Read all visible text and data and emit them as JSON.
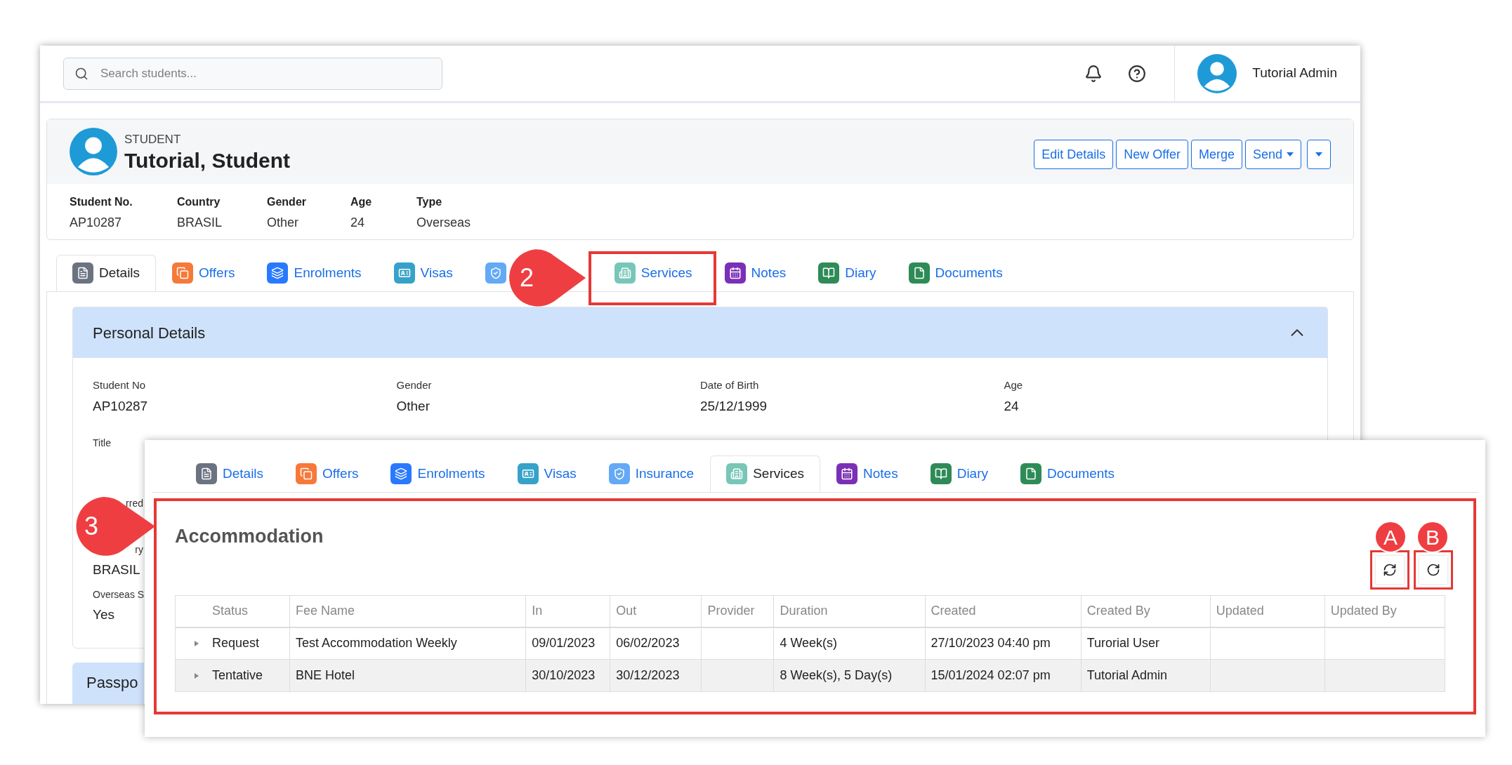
{
  "background_window": {
    "top_bar": {
      "search": {
        "placeholder": "Search students..."
      },
      "user_name": "Tutorial Admin"
    },
    "student": {
      "label": "STUDENT",
      "name": "Tutorial, Student",
      "actions": [
        {
          "label": "Edit Details",
          "kind": "button"
        },
        {
          "label": "New Offer",
          "kind": "button"
        },
        {
          "label": "Merge",
          "kind": "button"
        },
        {
          "label": "Send",
          "kind": "dropdown"
        },
        {
          "kind": "caret"
        }
      ],
      "facts": [
        {
          "label": "Student No.",
          "value": "AP10287"
        },
        {
          "label": "Country",
          "value": "BRASIL"
        },
        {
          "label": "Gender",
          "value": "Other"
        },
        {
          "label": "Age",
          "value": "24"
        },
        {
          "label": "Type",
          "value": "Overseas"
        }
      ]
    },
    "tabs": [
      {
        "label": "Details",
        "kind": "details",
        "color": "#6b7280",
        "selected": true
      },
      {
        "label": "Offers",
        "kind": "offers",
        "color": "#f6793a",
        "selected": false
      },
      {
        "label": "Enrolments",
        "kind": "enrolments",
        "color": "#2979ff",
        "selected": false
      },
      {
        "label": "Visas",
        "kind": "visas",
        "color": "#36a2c9",
        "selected": false
      },
      {
        "kind": "insurance",
        "color": "#64a9f5",
        "selected": false
      },
      {
        "label": "Services",
        "kind": "services",
        "color": "#78c6b7",
        "selected": false
      },
      {
        "label": "Notes",
        "kind": "notes",
        "color": "#7b2fb6",
        "selected": false
      },
      {
        "label": "Diary",
        "kind": "diary",
        "color": "#2e8b57",
        "selected": false
      },
      {
        "label": "Documents",
        "kind": "documents",
        "color": "#2e8b57",
        "selected": false
      }
    ],
    "personal_details": {
      "title": "Personal Details",
      "expanded": true,
      "fields": [
        {
          "label": "Student No",
          "value": "AP10287"
        },
        {
          "label": "Gender",
          "value": "Other"
        },
        {
          "label": "Date of Birth",
          "value": "25/12/1999"
        },
        {
          "label": "Age",
          "value": "24"
        }
      ],
      "partial_fields": [
        {
          "label": "Title",
          "clipped": false
        },
        {
          "label": "rred",
          "clipped": true
        },
        {
          "label": "ry",
          "clipped": true,
          "value": "BRASIL"
        },
        {
          "label": "Overseas S",
          "clipped": false,
          "value": "Yes"
        }
      ]
    },
    "next_panel_title": "Passpo"
  },
  "overlay_window": {
    "tabs": [
      {
        "label": "Details",
        "kind": "details",
        "color": "#6b7280",
        "selected": false
      },
      {
        "label": "Offers",
        "kind": "offers",
        "color": "#f6793a",
        "selected": false
      },
      {
        "label": "Enrolments",
        "kind": "enrolments",
        "color": "#2979ff",
        "selected": false
      },
      {
        "label": "Visas",
        "kind": "visas",
        "color": "#36a2c9",
        "selected": false
      },
      {
        "label": "Insurance",
        "kind": "insurance",
        "color": "#64a9f5",
        "selected": false
      },
      {
        "label": "Services",
        "kind": "services",
        "color": "#78c6b7",
        "selected": true
      },
      {
        "label": "Notes",
        "kind": "notes",
        "color": "#7b2fb6",
        "selected": false
      },
      {
        "label": "Diary",
        "kind": "diary",
        "color": "#2e8b57",
        "selected": false
      },
      {
        "label": "Documents",
        "kind": "documents",
        "color": "#2e8b57",
        "selected": false
      }
    ],
    "section": {
      "title": "Accommodation",
      "table": {
        "columns": [
          "Status",
          "Fee Name",
          "In",
          "Out",
          "Provider",
          "Duration",
          "Created",
          "Created By",
          "Updated",
          "Updated By"
        ],
        "rows": [
          {
            "expanded": false,
            "cells": [
              "Request",
              "Test Accommodation Weekly",
              "09/01/2023",
              "06/02/2023",
              "",
              "4 Week(s)",
              "27/10/2023 04:40 pm",
              "Turorial User",
              "",
              ""
            ]
          },
          {
            "expanded": false,
            "cells": [
              "Tentative",
              "BNE Hotel",
              "30/10/2023",
              "30/12/2023",
              "",
              "8 Week(s), 5 Day(s)",
              "15/01/2024 02:07 pm",
              "Tutorial Admin",
              "",
              ""
            ]
          }
        ]
      }
    }
  },
  "annotations": [
    {
      "label": "2",
      "kind": "pointer"
    },
    {
      "label": "3",
      "kind": "pointer"
    },
    {
      "label": "A",
      "kind": "marker"
    },
    {
      "label": "B",
      "kind": "marker"
    }
  ]
}
